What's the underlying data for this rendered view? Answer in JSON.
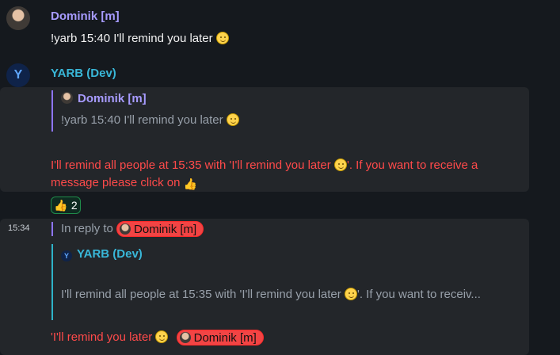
{
  "messages": [
    {
      "author": "Dominik [m]",
      "text": "!yarb 15:40 I'll remind you later"
    },
    {
      "author": "YARB (Dev)",
      "avatar_letter": "Y",
      "quote": {
        "author": "Dominik [m]",
        "text": "!yarb 15:40 I'll remind you later"
      },
      "body_line1": "I'll remind all people at 15:35 with 'I'll remind you later",
      "body_line1_tail": "'. If you want to receive a",
      "body_line2": "message please click on",
      "reaction": {
        "emoji": "👍",
        "count": "2"
      }
    },
    {
      "time": "15:34",
      "reply_to_label": "In reply to",
      "reply_to_user": "Dominik [m]",
      "quote": {
        "author": "YARB (Dev)",
        "text_start": "I'll remind all people at 15:35 with 'I'll remind you later",
        "text_end": "'. If you want to receiv..."
      },
      "body_text": "'I'll remind you later",
      "mention": "Dominik [m]"
    }
  ],
  "colors": {
    "background": "#15191e",
    "dominik_name": "#a79bff",
    "yarb_name": "#39b7d8",
    "red_text": "#ff4a4a",
    "panel": "#23262a"
  },
  "icons": [
    "dominik-avatar-icon",
    "yarb-avatar-icon",
    "smile-emoji",
    "thumbs-up-emoji"
  ]
}
